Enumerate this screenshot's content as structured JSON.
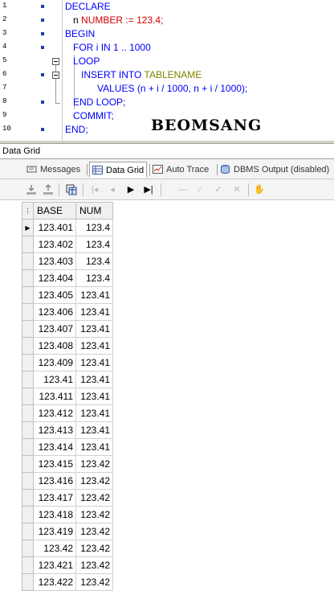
{
  "editor": {
    "line_numbers": [
      "1",
      "2",
      "3",
      "4",
      "5",
      "6",
      "7",
      "8",
      "9",
      "10"
    ],
    "code": {
      "l1": {
        "kw": "DECLARE"
      },
      "l2": {
        "indent": "   ",
        "ident": "n",
        "type": "NUMBER",
        "op": " := ",
        "num": "123.4",
        "end": ";"
      },
      "l3": {
        "kw": "BEGIN"
      },
      "l4": {
        "indent": "   ",
        "kw_for": "FOR",
        "ident": " i ",
        "kw_in": "IN",
        "range_a": " 1",
        "dots": " .. ",
        "range_b": "1000"
      },
      "l5": {
        "indent": "   ",
        "kw": "LOOP"
      },
      "l6": {
        "indent": "      ",
        "kw": "INSERT INTO",
        "tbl": "TABLENAME"
      },
      "l7": {
        "indent": "            ",
        "kw": "VALUES",
        "rest": " (n + i / ",
        "n1": "1000",
        "mid": ", n + i / ",
        "n2": "1000",
        "end": ");"
      },
      "l8": {
        "indent": "   ",
        "kw": "END LOOP",
        "end": ";"
      },
      "l9": {
        "indent": "   ",
        "kw": "COMMIT",
        "end": ";"
      },
      "l10": {
        "kw": "END",
        "end": ";"
      }
    },
    "watermark": "BEOMSANG"
  },
  "panel_title": "Data Grid",
  "tabs": [
    {
      "label": "Messages",
      "icon": "messages-icon"
    },
    {
      "label": "Data Grid",
      "icon": "grid-icon"
    },
    {
      "label": "Auto Trace",
      "icon": "trace-icon"
    },
    {
      "label": "DBMS Output (disabled)",
      "icon": "dbms-output-icon"
    }
  ],
  "toolbar_icons": [
    "import-icon",
    "export-icon",
    "copy-grid-icon",
    "first-record-icon",
    "prev-record-icon",
    "next-record-icon",
    "last-record-icon",
    "insert-record-icon",
    "edit-record-icon",
    "post-record-icon",
    "cancel-record-icon",
    "hand-icon"
  ],
  "grid": {
    "columns": [
      "BASE",
      "NUM"
    ],
    "rows": [
      [
        "123.401",
        "123.4"
      ],
      [
        "123.402",
        "123.4"
      ],
      [
        "123.403",
        "123.4"
      ],
      [
        "123.404",
        "123.4"
      ],
      [
        "123.405",
        "123.41"
      ],
      [
        "123.406",
        "123.41"
      ],
      [
        "123.407",
        "123.41"
      ],
      [
        "123.408",
        "123.41"
      ],
      [
        "123.409",
        "123.41"
      ],
      [
        "123.41",
        "123.41"
      ],
      [
        "123.411",
        "123.41"
      ],
      [
        "123.412",
        "123.41"
      ],
      [
        "123.413",
        "123.41"
      ],
      [
        "123.414",
        "123.41"
      ],
      [
        "123.415",
        "123.42"
      ],
      [
        "123.416",
        "123.42"
      ],
      [
        "123.417",
        "123.42"
      ],
      [
        "123.418",
        "123.42"
      ],
      [
        "123.419",
        "123.42"
      ],
      [
        "123.42",
        "123.42"
      ],
      [
        "123.421",
        "123.42"
      ],
      [
        "123.422",
        "123.42"
      ]
    ]
  }
}
